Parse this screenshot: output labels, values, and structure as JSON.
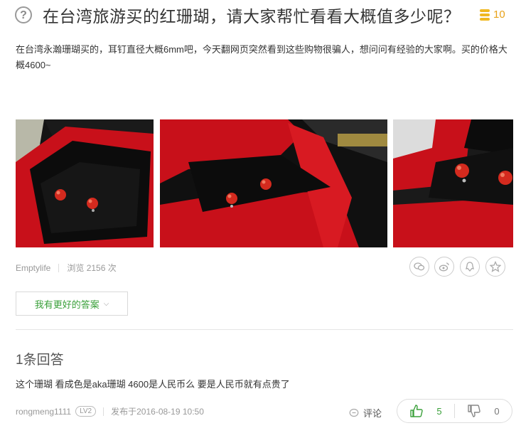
{
  "question": {
    "icon_text": "?",
    "title": "在台湾旅游买的红珊瑚，请大家帮忙看看大概值多少呢？",
    "reward": "10",
    "description": "在台湾永瀚珊瑚买的，耳钉直径大概6mm吧，今天翻网页突然看到这些购物很骗人，想问问有经验的大家啊。买的价格大概4600~"
  },
  "meta": {
    "author": "Emptylife",
    "views": "浏览 2156 次"
  },
  "share_icons": [
    "wechat-icon",
    "weibo-icon",
    "qq-icon",
    "favorite-icon"
  ],
  "answer_button": {
    "label": "我有更好的答案"
  },
  "answers": {
    "count_label": "1条回答",
    "items": [
      {
        "text": "这个珊瑚 看成色是aka珊瑚 4600是人民币么 要是人民币就有点贵了",
        "user": "rongmeng1111",
        "level": "LV2",
        "published": "发布于2016-08-19 10:50",
        "comment_label": "评论",
        "upvotes": "5",
        "downvotes": "0"
      }
    ]
  },
  "colors": {
    "accent_green": "#3aa03a",
    "reward_gold": "#e8a21a",
    "box_red": "#c8101a"
  }
}
